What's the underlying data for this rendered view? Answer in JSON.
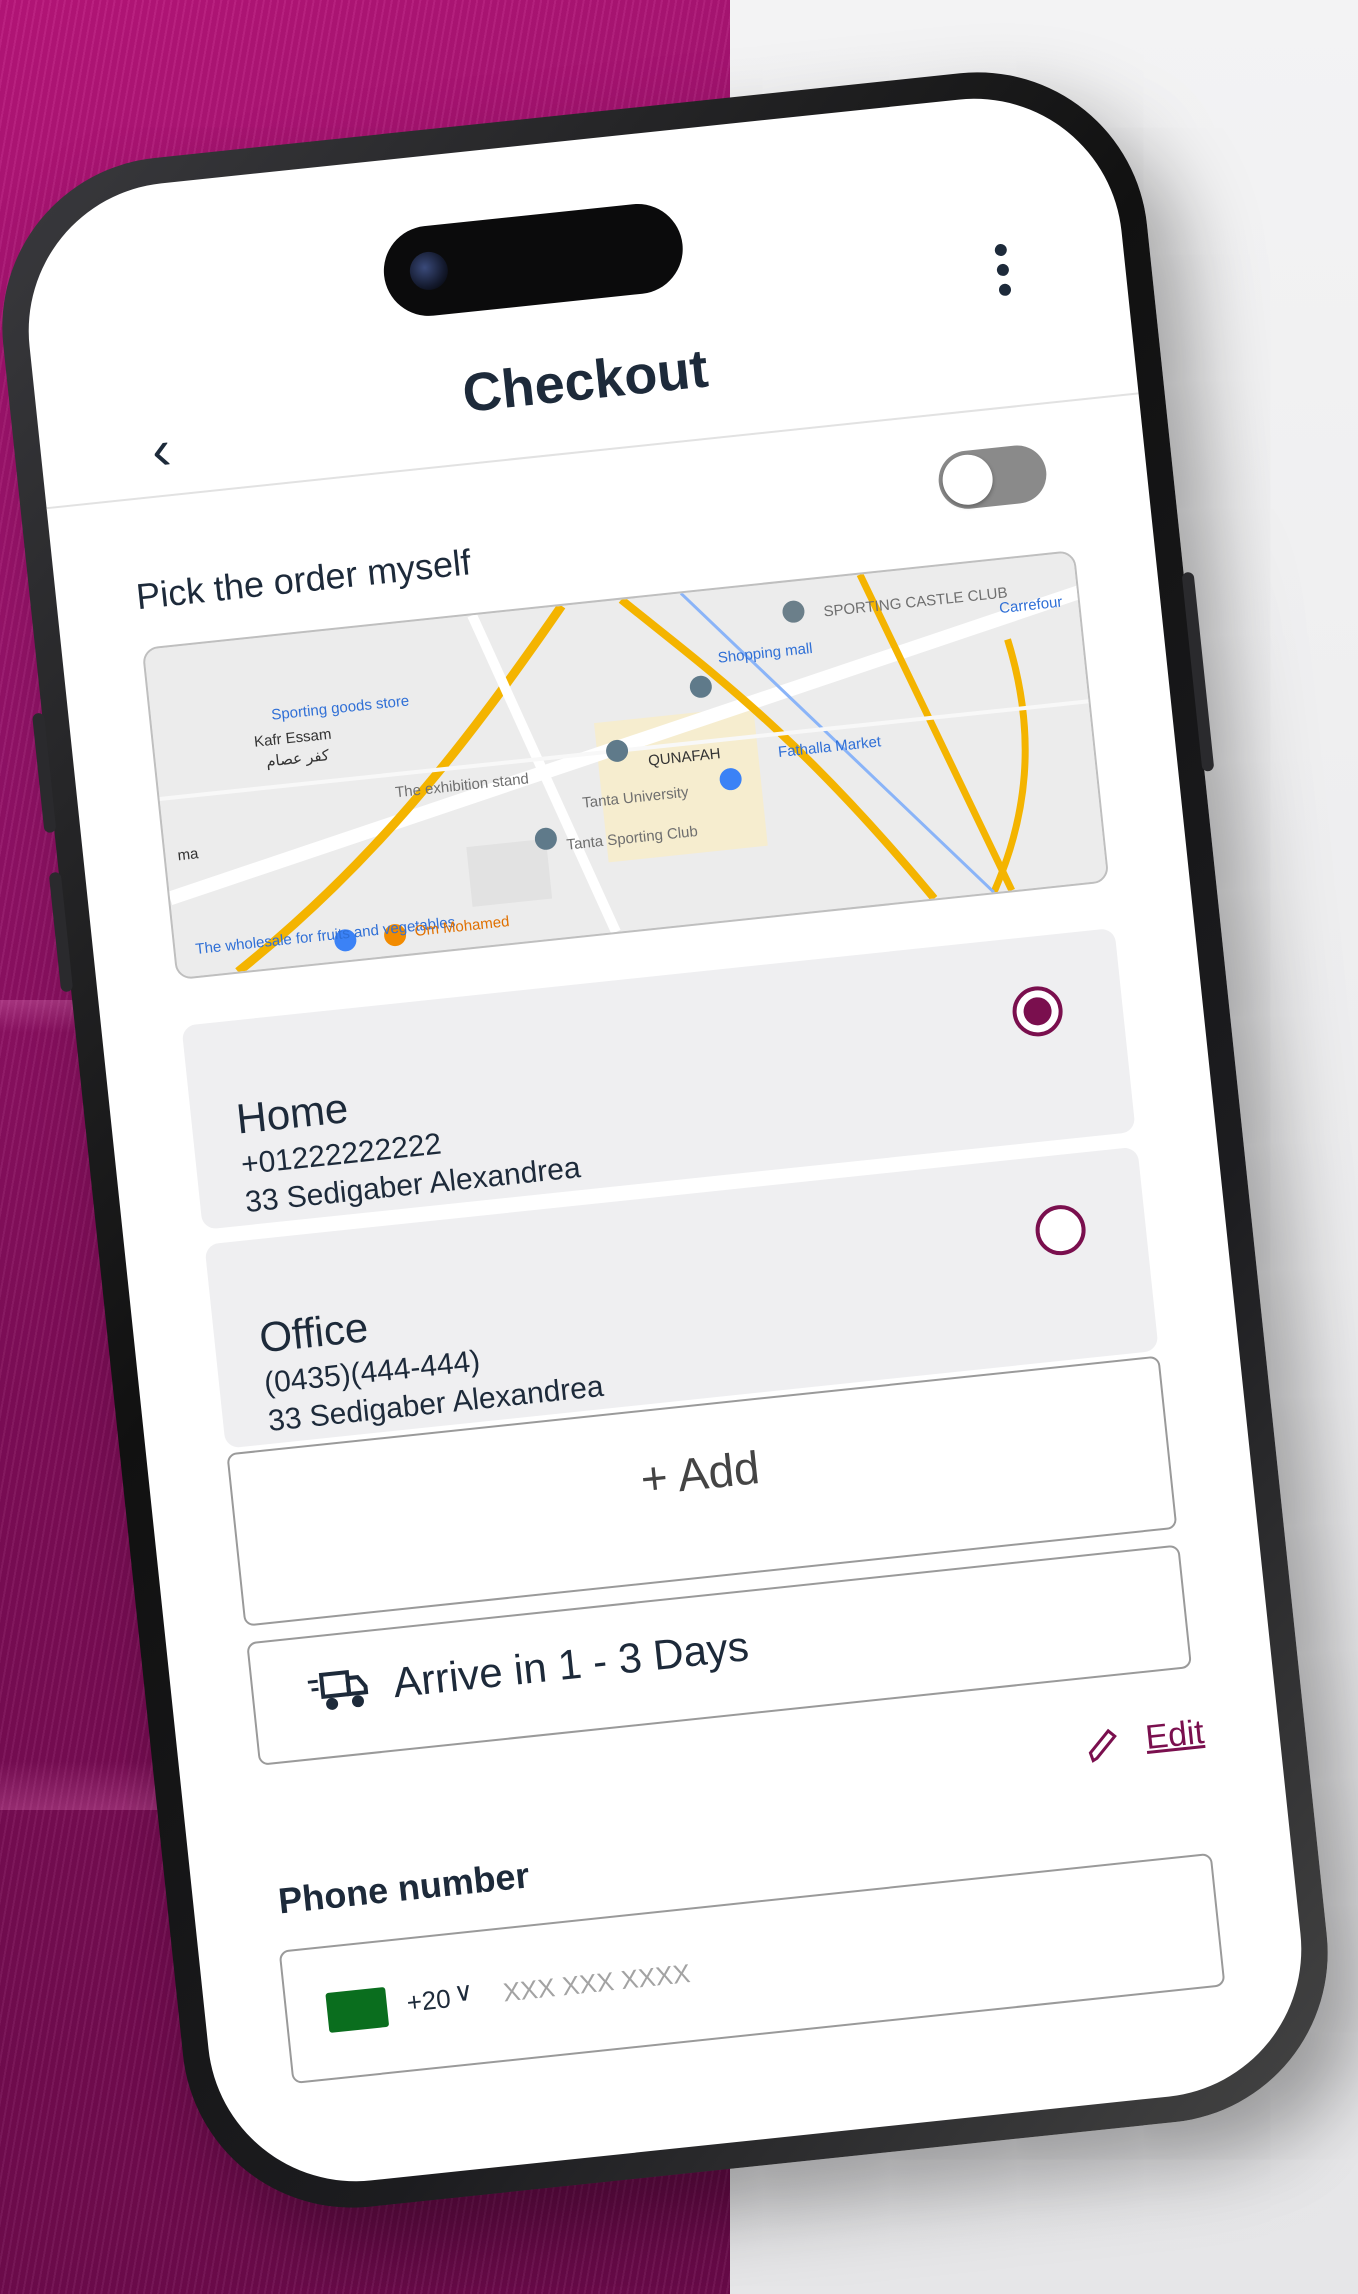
{
  "header": {
    "title": "Checkout",
    "back_icon": "‹"
  },
  "pickup": {
    "label": "Pick the order myself",
    "toggle_on": false
  },
  "map": {
    "labels": [
      "Kafr Essam",
      "كفر عصام",
      "The exhibition stand",
      "QUNAFAH",
      "Tanta University",
      "Tanta Sporting Club",
      "SPORTING CASTLE CLUB",
      "Carrefour",
      "Fathalla Market",
      "The wholesale for fruits and vegetables",
      "Om Mohamed",
      "Shopping mall",
      "Sporting goods store",
      "ma"
    ]
  },
  "addresses": [
    {
      "name": "Home",
      "phone": "+01222222222",
      "street": "33 Sedigaber Alexandrea",
      "selected": true
    },
    {
      "name": "Office",
      "phone": "(0435)(444-444)",
      "street": "33 Sedigaber Alexandrea",
      "selected": false
    }
  ],
  "add_button": {
    "label": "+ Add"
  },
  "shipping": {
    "label": "Arrive in 1 - 3 Days",
    "icon": "truck-icon"
  },
  "edit": {
    "label": "Edit"
  },
  "phone": {
    "label": "Phone number",
    "country_code": "+20",
    "chevron": "∨",
    "placeholder": "XXX XXX XXXX"
  },
  "colors": {
    "accent": "#7a0f4e",
    "background_left": "#8a1262",
    "text": "#1d2a3a"
  }
}
